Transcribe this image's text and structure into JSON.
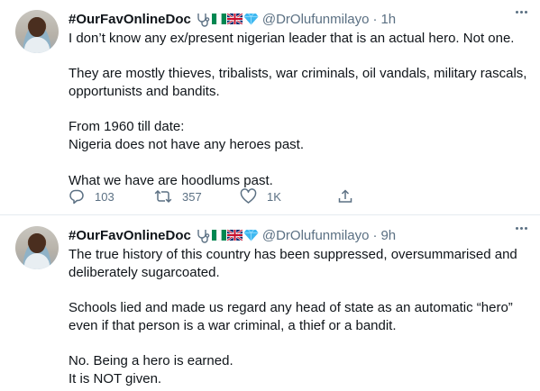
{
  "tweets": [
    {
      "author_name": "#OurFavOnlineDoc",
      "badges": [
        "stethoscope-icon",
        "nigeria-flag-icon",
        "uk-flag-icon",
        "gem-icon"
      ],
      "handle": "@DrOlufunmilayo",
      "separator": "·",
      "time": "1h",
      "lines": [
        "I don’t know any ex/present nigerian leader that is an actual hero. Not one.",
        "",
        "They are mostly thieves, tribalists, war criminals, oil vandals, military rascals,",
        "opportunists and bandits.",
        "",
        "From 1960 till date:",
        "Nigeria does not have any heroes past.",
        "",
        "What we have are hoodlums past."
      ],
      "replies": "103",
      "retweets": "357",
      "likes": "1K"
    },
    {
      "author_name": "#OurFavOnlineDoc",
      "badges": [
        "stethoscope-icon",
        "nigeria-flag-icon",
        "uk-flag-icon",
        "gem-icon"
      ],
      "handle": "@DrOlufunmilayo",
      "separator": "·",
      "time": "9h",
      "lines": [
        "The true history of this country has been suppressed, oversummarised and",
        "deliberately sugarcoated.",
        "",
        "Schools lied and made us regard any head of state as an automatic “hero”",
        "even if that person is a war criminal, a thief or a bandit.",
        "",
        "No. Being a hero is earned.",
        "It is NOT given."
      ]
    }
  ],
  "colors": {
    "text": "#0f1419",
    "secondary": "#5b7083",
    "divider": "#e6ecf0",
    "gem": "#3fb8f0",
    "flag_green": "#008751"
  }
}
